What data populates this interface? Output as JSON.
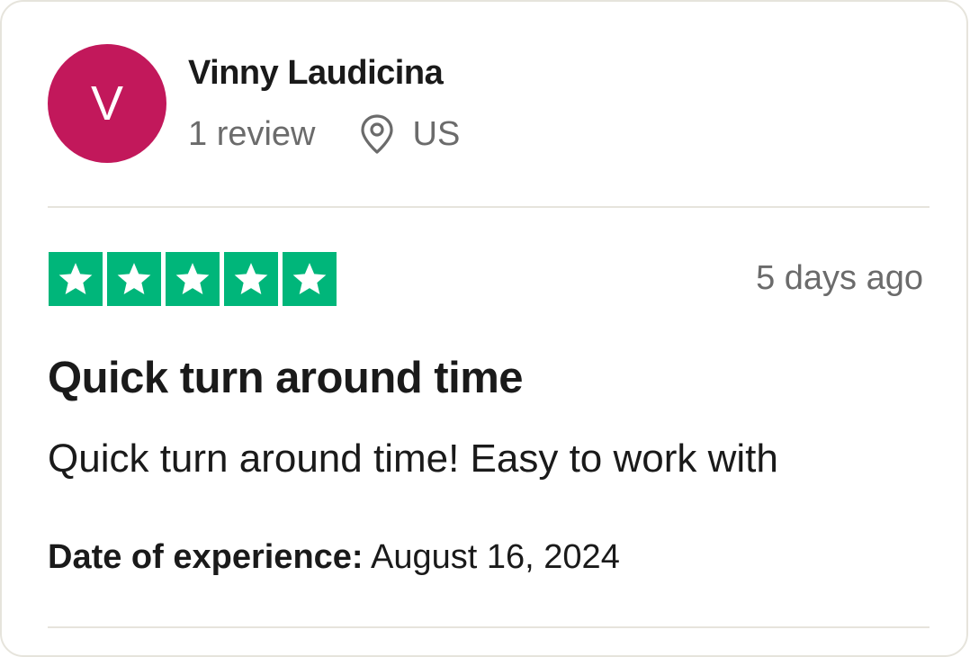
{
  "reviewer": {
    "avatar_initial": "V",
    "avatar_color": "#c2185b",
    "name": "Vinny Laudicina",
    "review_count": "1 review",
    "location_icon": "location-pin-icon",
    "country": "US"
  },
  "review": {
    "rating": 5,
    "rating_max": 5,
    "star_color": "#00b67a",
    "date_relative": "5 days ago",
    "title": "Quick turn around time",
    "body": "Quick turn around time! Easy to work with",
    "experience_label": "Date of experience:",
    "experience_date": "August 16, 2024"
  }
}
